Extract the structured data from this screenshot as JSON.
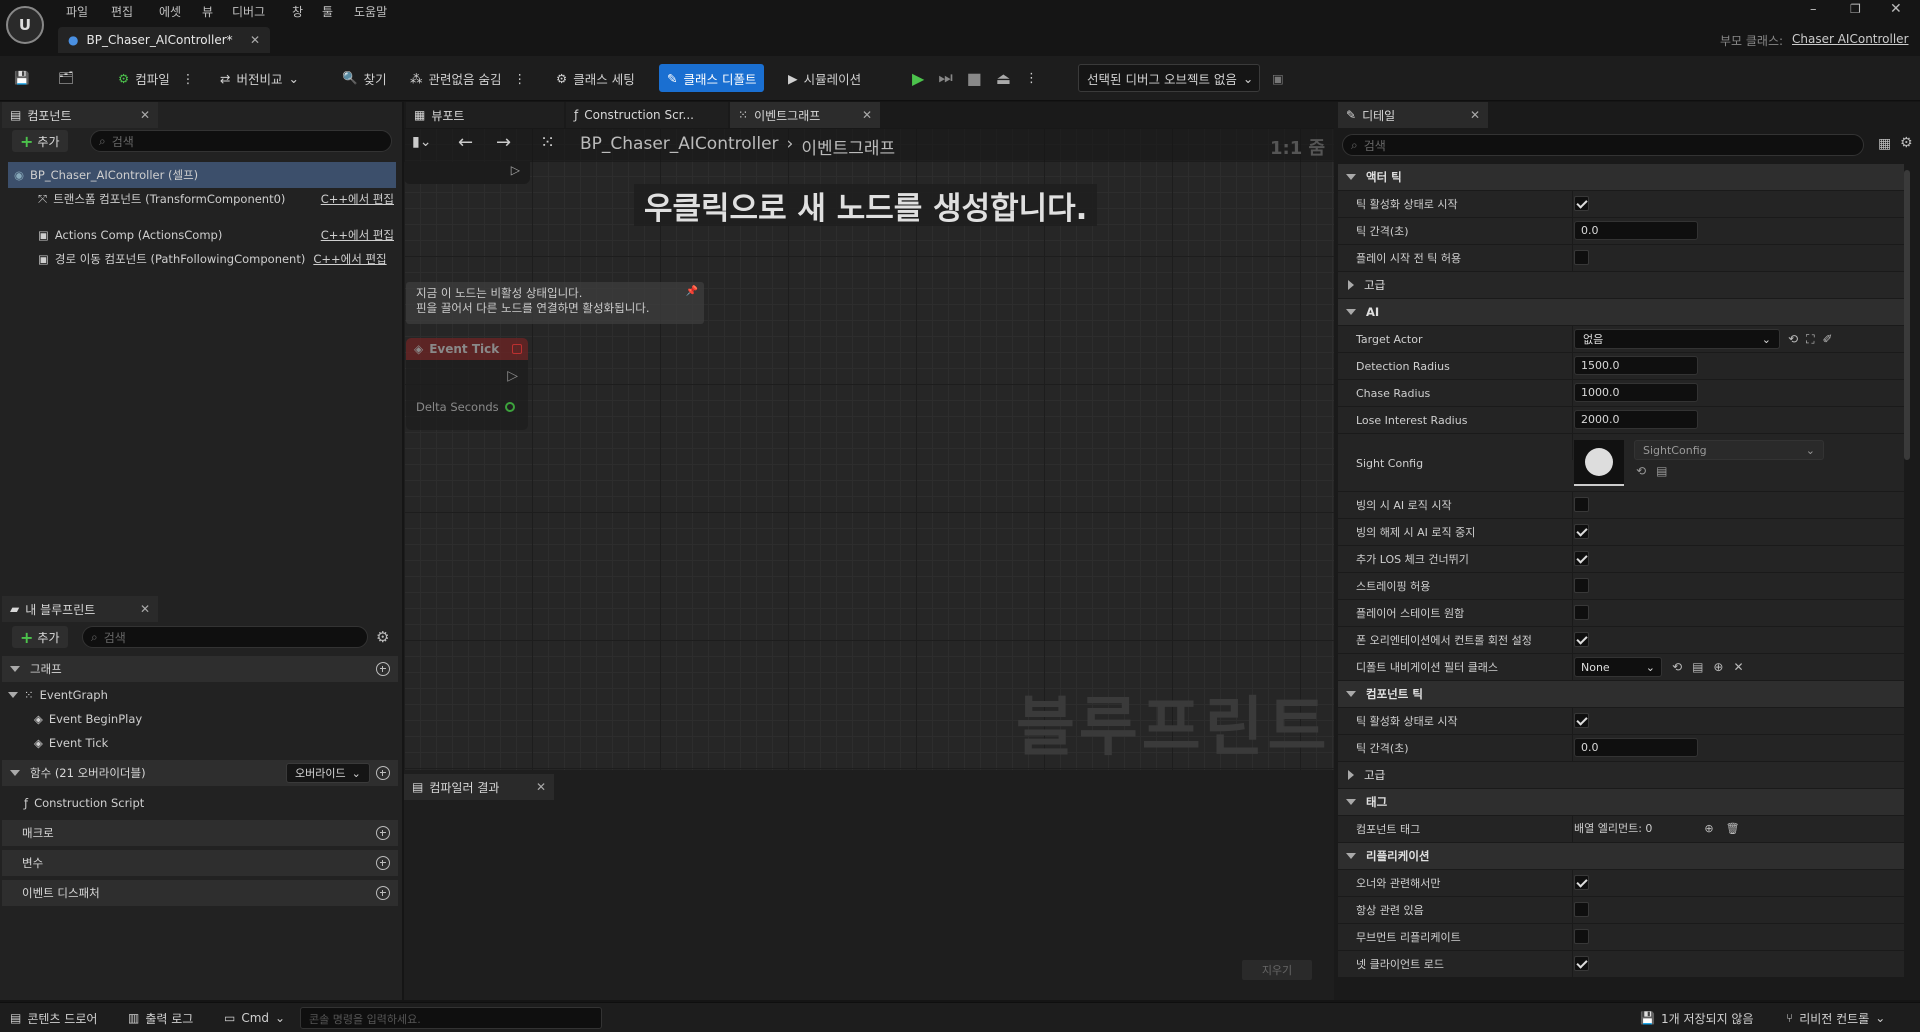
{
  "menu": [
    "파일",
    "편집",
    "에셋",
    "뷰",
    "디버그",
    "창",
    "툴",
    "도움말"
  ],
  "doc_tab": "BP_Chaser_AIController*",
  "parent_class": {
    "label": "부모 클래스:",
    "value": "Chaser AIController"
  },
  "toolbar": {
    "compile": "컴파일",
    "diff": "버전비교",
    "find": "찾기",
    "hide_unrelated": "관련없음 숨김",
    "class_settings": "클래스 세팅",
    "class_defaults": "클래스 디폴트",
    "simulation": "시뮬레이션",
    "debug_object": "선택된 디버그 오브젝트 없음"
  },
  "components": {
    "tab": "컴포넌트",
    "add": "추가",
    "search_placeholder": "검색",
    "items": [
      {
        "label": "BP_Chaser_AIController (셀프)",
        "edit": ""
      },
      {
        "label": "트랜스폼 컴포넌트 (TransformComponent0)",
        "edit": "C++에서 편집"
      },
      {
        "label": "Actions Comp (ActionsComp)",
        "edit": "C++에서 편집"
      },
      {
        "label": "경로 이동 컴포넌트 (PathFollowingComponent)",
        "edit": "C++에서 편집"
      }
    ]
  },
  "my_blueprint": {
    "tab": "내 블루프린트",
    "add": "추가",
    "search_placeholder": "검색",
    "graph_section": "그래프",
    "event_graph": "EventGraph",
    "begin_play": "Event BeginPlay",
    "event_tick": "Event Tick",
    "functions_section": "함수 (21 오버라이더블)",
    "override": "오버라이드",
    "construction_script": "Construction Script",
    "macros": "매크로",
    "variables": "변수",
    "dispatchers": "이벤트 디스패처"
  },
  "graph_tabs": [
    "뷰포트",
    "Construction Scr...",
    "이벤트그래프"
  ],
  "graph": {
    "breadcrumb_root": "BP_Chaser_AIController",
    "breadcrumb_leaf": "이벤트그래프",
    "zoom": "1:1 줌",
    "hint": "우클릭으로 새 노드를 생성합니다.",
    "inactive_line1": "지금 이 노드는 비활성 상태입니다.",
    "inactive_line2": "핀을 끌어서 다른 노드를 연결하면 활성화됩니다.",
    "node_title": "Event Tick",
    "node_pin": "Delta Seconds",
    "watermark": "블루프린트"
  },
  "compiler": {
    "tab": "컴파일러 결과",
    "clear": "지우기"
  },
  "details": {
    "tab": "디테일",
    "search_placeholder": "검색",
    "actor_tick": "액터 틱",
    "tick_start_enabled": "틱 활성화 상태로 시작",
    "tick_interval": "틱 간격(초)",
    "tick_interval_value": "0.0",
    "tick_before_begin": "플레이 시작 전 틱 허용",
    "advanced": "고급",
    "ai": "AI",
    "target_actor": "Target Actor",
    "target_actor_value": "없음",
    "detection_radius": "Detection Radius",
    "detection_radius_value": "1500.0",
    "chase_radius": "Chase Radius",
    "chase_radius_value": "1000.0",
    "lose_radius": "Lose Interest Radius",
    "lose_radius_value": "2000.0",
    "sight_config": "Sight Config",
    "sight_config_value": "SightConfig",
    "start_ai_on_possess": "빙의 시 AI 로직 시작",
    "stop_ai_on_unpossess": "빙의 해제 시 AI 로직 중지",
    "skip_los": "추가 LOS 체크 건너뛰기",
    "allow_strafe": "스트레이핑 허용",
    "wants_player_state": "플레이어 스테이트 원함",
    "pawn_control_rotation": "폰 오리엔테이션에서 컨트롤 회전 설정",
    "nav_filter": "디폴트 내비게이션 필터 클래스",
    "nav_filter_value": "None",
    "component_tick": "컴포넌트 틱",
    "ctick_start_enabled": "틱 활성화 상태로 시작",
    "ctick_interval": "틱 간격(초)",
    "ctick_interval_value": "0.0",
    "advanced2": "고급",
    "tags": "태그",
    "component_tags": "컴포넌트 태그",
    "component_tags_value": "배열 엘리먼트: 0",
    "replication": "리플리케이션",
    "only_relevant_to_owner": "오너와 관련해서만",
    "always_relevant": "항상 관련 있음",
    "replicate_movement": "무브먼트 리플리케이트",
    "net_load_on_client": "넷 클라이언트 로드"
  },
  "statusbar": {
    "content_drawer": "콘텐츠 드로어",
    "output_log": "출력 로그",
    "cmd": "Cmd",
    "console_placeholder": "콘솔 명령을 입력하세요.",
    "unsaved": "1개 저장되지 않음",
    "revision": "리비전 컨트롤"
  },
  "colors": {
    "accent": "#1a6fd1",
    "play": "#4cc34c",
    "node_red": "#c0392b"
  }
}
